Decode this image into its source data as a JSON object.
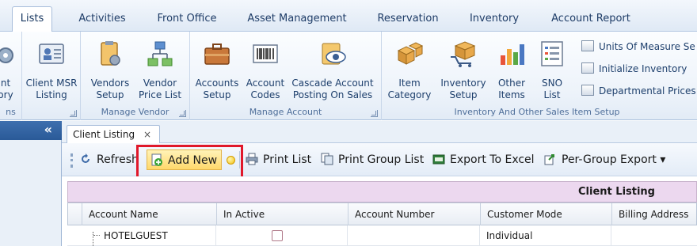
{
  "ribbon_tabs": [
    "Lists",
    "Activities",
    "Front Office",
    "Asset Management",
    "Reservation",
    "Inventory",
    "Account Report"
  ],
  "ribbon": {
    "groups": [
      {
        "caption": "ns",
        "buttons": [
          {
            "label": "nt\nory"
          }
        ]
      },
      {
        "caption": "",
        "buttons": [
          {
            "label": "Client MSR\nListing"
          }
        ]
      },
      {
        "caption": "Manage Vendor",
        "buttons": [
          {
            "label": "Vendors\nSetup"
          },
          {
            "label": "Vendor\nPrice List"
          }
        ]
      },
      {
        "caption": "Manage Account",
        "buttons": [
          {
            "label": "Accounts\nSetup"
          },
          {
            "label": "Account\nCodes"
          },
          {
            "label": "Cascade Account\nPosting On Sales"
          }
        ]
      },
      {
        "caption": "Inventory And Other Sales Item Setup",
        "buttons": [
          {
            "label": "Item\nCategory"
          },
          {
            "label": "Inventory\nSetup"
          },
          {
            "label": "Other\nItems"
          },
          {
            "label": "SNO\nList"
          }
        ]
      }
    ],
    "small_commands": [
      "Units Of Measure Se",
      "Initialize Inventory",
      "Departmental Prices"
    ]
  },
  "nav": {
    "collapse_glyph": "«"
  },
  "doc_tab": {
    "label": "Client Listing",
    "close": "×"
  },
  "toolbar": {
    "refresh": "Refresh",
    "add_new": "Add New",
    "print_list": "Print List",
    "print_group_list": "Print Group List",
    "export_excel": "Export To Excel",
    "per_group_export": "Per-Group Export ▾"
  },
  "grid": {
    "caption": "Client Listing",
    "columns": [
      "Account Name",
      "In Active",
      "Account Number",
      "Customer Mode",
      "Billing Address"
    ],
    "rows": [
      {
        "account_name": "HOTELGUEST",
        "in_active": false,
        "account_number": "",
        "customer_mode": "Individual",
        "billing_address": ""
      }
    ]
  },
  "colors": {
    "highlight": "#e0182a",
    "caption_bg": "#ecd8ef",
    "nav_header": "#2a5a98"
  }
}
